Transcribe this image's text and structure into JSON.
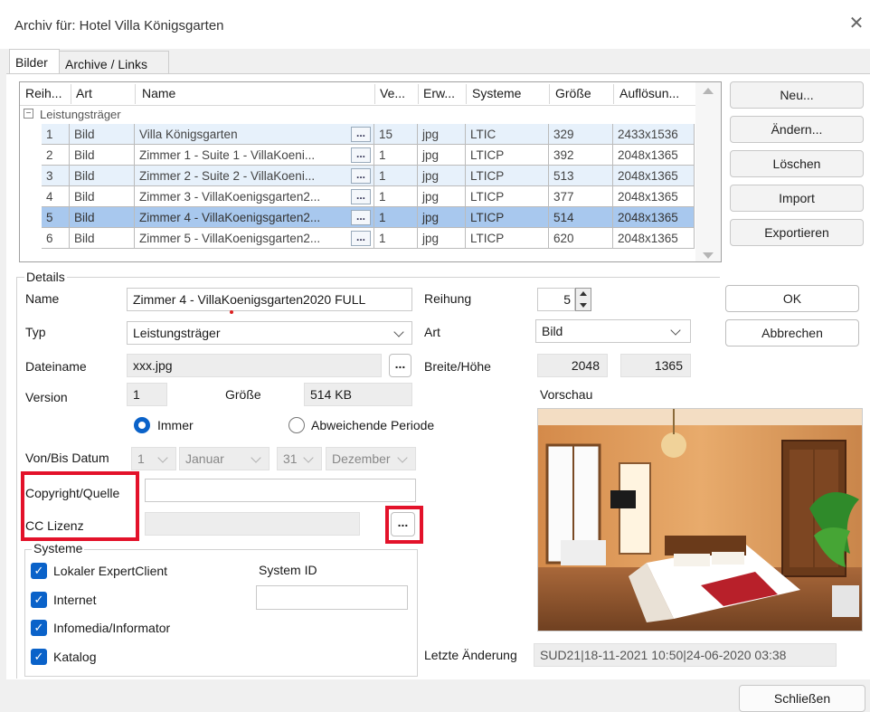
{
  "window": {
    "title": "Archiv für: Hotel Villa Königsgarten"
  },
  "tabs": [
    {
      "label": "Bilder"
    },
    {
      "label": "Archive / Links"
    }
  ],
  "grid": {
    "headers": [
      "Reih...",
      "Art",
      "Name",
      "Ve...",
      "Erw...",
      "Systeme",
      "Größe",
      "Auflösun..."
    ],
    "group_label": "Leistungsträger",
    "rows": [
      {
        "nr": "1",
        "art": "Bild",
        "name": "Villa Königsgarten",
        "ver": "15",
        "erw": "jpg",
        "sys": "LTIC",
        "size": "329",
        "res": "2433x1536"
      },
      {
        "nr": "2",
        "art": "Bild",
        "name": "Zimmer 1 - Suite 1 - VillaKoeni...",
        "ver": "1",
        "erw": "jpg",
        "sys": "LTICP",
        "size": "392",
        "res": "2048x1365"
      },
      {
        "nr": "3",
        "art": "Bild",
        "name": "Zimmer 2 - Suite 2 - VillaKoeni...",
        "ver": "1",
        "erw": "jpg",
        "sys": "LTICP",
        "size": "513",
        "res": "2048x1365"
      },
      {
        "nr": "4",
        "art": "Bild",
        "name": "Zimmer 3 - VillaKoenigsgarten2...",
        "ver": "1",
        "erw": "jpg",
        "sys": "LTICP",
        "size": "377",
        "res": "2048x1365"
      },
      {
        "nr": "5",
        "art": "Bild",
        "name": "Zimmer 4 - VillaKoenigsgarten2...",
        "ver": "1",
        "erw": "jpg",
        "sys": "LTICP",
        "size": "514",
        "res": "2048x1365"
      },
      {
        "nr": "6",
        "art": "Bild",
        "name": "Zimmer 5 - VillaKoenigsgarten2...",
        "ver": "1",
        "erw": "jpg",
        "sys": "LTICP",
        "size": "620",
        "res": "2048x1365"
      }
    ],
    "dots": "..."
  },
  "side_buttons": {
    "neu": "Neu...",
    "aendern": "Ändern...",
    "loeschen": "Löschen",
    "import": "Import",
    "exportieren": "Exportieren"
  },
  "details": {
    "legend": "Details",
    "name_label": "Name",
    "name_value": "Zimmer 4 - VillaKoenigsgarten2020 FULL",
    "typ_label": "Typ",
    "typ_value": "Leistungsträger",
    "dateiname_label": "Dateiname",
    "dateiname_value": "xxx.jpg",
    "version_label": "Version",
    "version_value": "1",
    "groesse_label": "Größe",
    "groesse_value": "514 KB",
    "radio_immer": "Immer",
    "radio_abw": "Abweichende Periode",
    "vonbis_label": "Von/Bis Datum",
    "von_day": "1",
    "von_month": "Januar",
    "bis_day": "31",
    "bis_month": "Dezember",
    "copyright_label": "Copyright/Quelle",
    "copyright_value": "",
    "cc_label": "CC Lizenz",
    "cc_value": "",
    "reihung_label": "Reihung",
    "reihung_value": "5",
    "art_label": "Art",
    "art_value": "Bild",
    "bh_label": "Breite/Höhe",
    "breite": "2048",
    "hoehe": "1365",
    "vorschau_label": "Vorschau",
    "letzte_label": "Letzte Änderung",
    "letzte_value": "SUD21|18-11-2021 10:50|24-06-2020 03:38"
  },
  "systeme": {
    "legend": "Systeme",
    "items": [
      "Lokaler ExpertClient",
      "Internet",
      "Infomedia/Informator",
      "Katalog"
    ],
    "system_id_label": "System ID",
    "system_id_value": ""
  },
  "dialog_buttons": {
    "ok": "OK",
    "abbrechen": "Abbrechen",
    "schliessen": "Schließen"
  },
  "colors": {
    "accent": "#0a62c9",
    "highlight": "#e3122a",
    "row_selected": "#a8c8ee",
    "row_alt": "#e7f1fb"
  }
}
